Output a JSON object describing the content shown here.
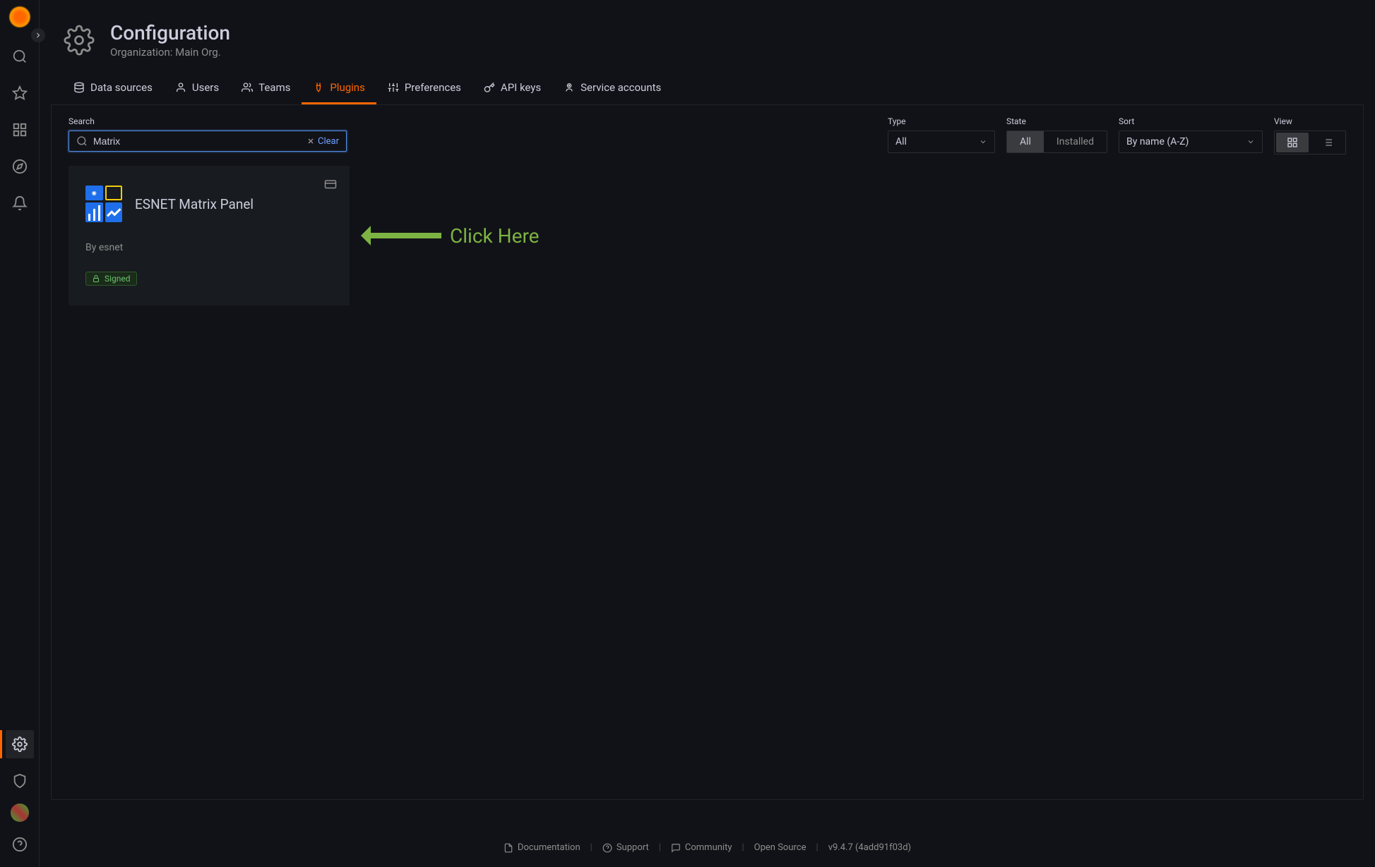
{
  "header": {
    "title": "Configuration",
    "subtitle": "Organization: Main Org."
  },
  "tabs": [
    {
      "label": "Data sources"
    },
    {
      "label": "Users"
    },
    {
      "label": "Teams"
    },
    {
      "label": "Plugins"
    },
    {
      "label": "Preferences"
    },
    {
      "label": "API keys"
    },
    {
      "label": "Service accounts"
    }
  ],
  "filters": {
    "search_label": "Search",
    "search_value": "Matrix",
    "clear_label": "Clear",
    "type_label": "Type",
    "type_value": "All",
    "state_label": "State",
    "state_options": [
      "All",
      "Installed"
    ],
    "sort_label": "Sort",
    "sort_value": "By name (A-Z)",
    "view_label": "View"
  },
  "card": {
    "title": "ESNET Matrix Panel",
    "author": "By esnet",
    "badge": "Signed"
  },
  "annotation": "Click Here",
  "footer": {
    "documentation": "Documentation",
    "support": "Support",
    "community": "Community",
    "open_source": "Open Source",
    "version": "v9.4.7 (4add91f03d)"
  }
}
